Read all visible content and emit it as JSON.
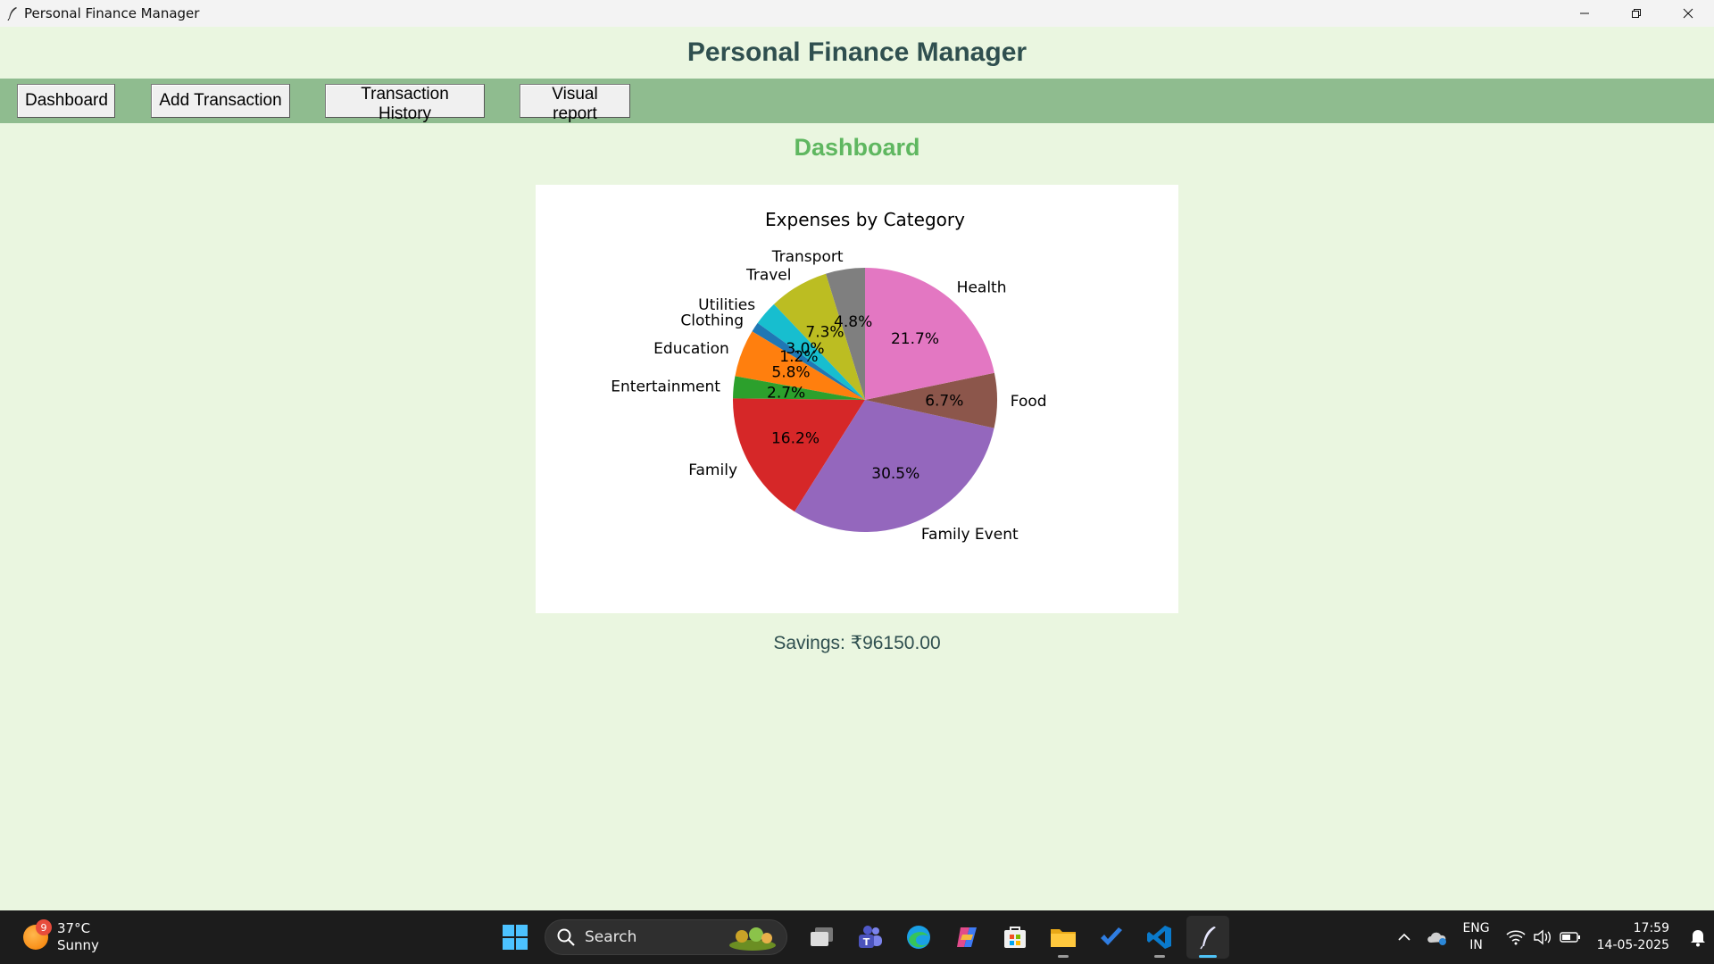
{
  "window": {
    "title": "Personal Finance Manager"
  },
  "header": {
    "title": "Personal Finance Manager"
  },
  "nav": {
    "buttons": [
      {
        "label": "Dashboard"
      },
      {
        "label": "Add Transaction"
      },
      {
        "label": "Transaction History"
      },
      {
        "label": "Visual report"
      }
    ]
  },
  "page": {
    "heading": "Dashboard",
    "savings_text": "Savings: ₹96150.00"
  },
  "colors": {
    "background": "#eaf6e0",
    "navbar": "#8fbc8f",
    "heading": "#5fb760",
    "title": "#2f4f4f"
  },
  "chart_data": {
    "type": "pie",
    "title": "Expenses by Category",
    "start_angle_deg": 90,
    "direction": "counterclockwise",
    "slices": [
      {
        "label": "Transport",
        "pct_label": "4.8%",
        "value": 4.8,
        "color": "#7f7f7f"
      },
      {
        "label": "Travel",
        "pct_label": "7.3%",
        "value": 7.3,
        "color": "#bcbd22"
      },
      {
        "label": "Utilities",
        "pct_label": "3.0%",
        "value": 3.0,
        "color": "#17becf"
      },
      {
        "label": "Clothing",
        "pct_label": "1.2%",
        "value": 1.2,
        "color": "#1f77b4"
      },
      {
        "label": "Education",
        "pct_label": "5.8%",
        "value": 5.8,
        "color": "#ff7f0e"
      },
      {
        "label": "Entertainment",
        "pct_label": "2.7%",
        "value": 2.7,
        "color": "#2ca02c"
      },
      {
        "label": "Family",
        "pct_label": "16.2%",
        "value": 16.2,
        "color": "#d62728"
      },
      {
        "label": "Family Event",
        "pct_label": "30.5%",
        "value": 30.5,
        "color": "#9467bd"
      },
      {
        "label": "Food",
        "pct_label": "6.7%",
        "value": 6.7,
        "color": "#8c564b"
      },
      {
        "label": "Health",
        "pct_label": "21.7%",
        "value": 21.7,
        "color": "#e377c2"
      }
    ]
  },
  "taskbar": {
    "weather_badge": "9",
    "weather_temp": "37°C",
    "weather_desc": "Sunny",
    "search_placeholder": "Search",
    "lang_line1": "ENG",
    "lang_line2": "IN",
    "time": "17:59",
    "date": "14-05-2025"
  }
}
